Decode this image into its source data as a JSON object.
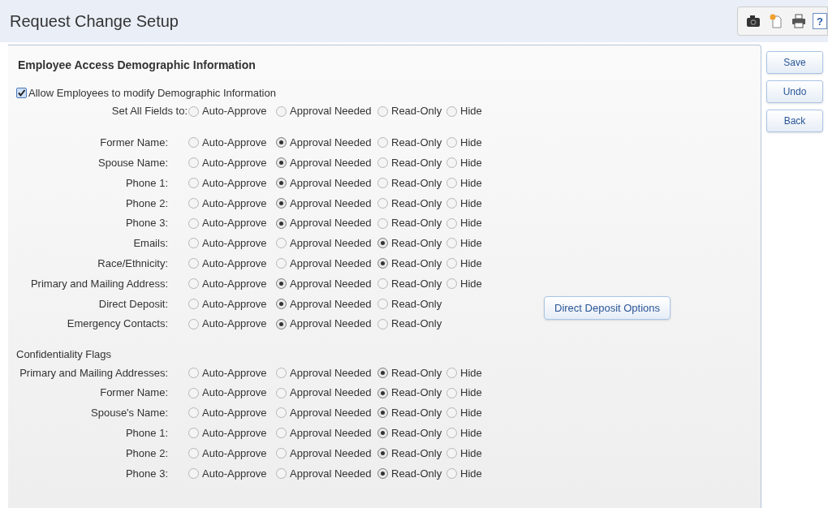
{
  "header": {
    "title": "Request Change Setup",
    "toolbar": [
      {
        "kind": "camera"
      },
      {
        "kind": "document"
      },
      {
        "kind": "printer"
      },
      {
        "kind": "help",
        "label": "?"
      }
    ]
  },
  "demographic": {
    "title": "Employee Access Demographic Information",
    "allow": {
      "label": "Allow Employees to modify Demographic Information",
      "checked": true
    },
    "set_all": {
      "label": "Set All Fields to:",
      "options": [
        {
          "label": "Auto-Approve",
          "selected": false
        },
        {
          "label": "Approval Needed",
          "selected": false
        },
        {
          "label": "Read-Only",
          "selected": false
        },
        {
          "label": "Hide",
          "selected": false
        }
      ]
    },
    "fields": [
      {
        "label": "Former Name:",
        "options": [
          {
            "label": "Auto-Approve",
            "selected": false
          },
          {
            "label": "Approval Needed",
            "selected": true
          },
          {
            "label": "Read-Only",
            "selected": false
          },
          {
            "label": "Hide",
            "selected": false
          }
        ]
      },
      {
        "label": "Spouse Name:",
        "options": [
          {
            "label": "Auto-Approve",
            "selected": false
          },
          {
            "label": "Approval Needed",
            "selected": true
          },
          {
            "label": "Read-Only",
            "selected": false
          },
          {
            "label": "Hide",
            "selected": false
          }
        ]
      },
      {
        "label": "Phone 1:",
        "options": [
          {
            "label": "Auto-Approve",
            "selected": false
          },
          {
            "label": "Approval Needed",
            "selected": true
          },
          {
            "label": "Read-Only",
            "selected": false
          },
          {
            "label": "Hide",
            "selected": false
          }
        ]
      },
      {
        "label": "Phone 2:",
        "options": [
          {
            "label": "Auto-Approve",
            "selected": false
          },
          {
            "label": "Approval Needed",
            "selected": true
          },
          {
            "label": "Read-Only",
            "selected": false
          },
          {
            "label": "Hide",
            "selected": false
          }
        ]
      },
      {
        "label": "Phone 3:",
        "options": [
          {
            "label": "Auto-Approve",
            "selected": false
          },
          {
            "label": "Approval Needed",
            "selected": true
          },
          {
            "label": "Read-Only",
            "selected": false
          },
          {
            "label": "Hide",
            "selected": false
          }
        ]
      },
      {
        "label": "Emails:",
        "options": [
          {
            "label": "Auto-Approve",
            "selected": false
          },
          {
            "label": "Approval Needed",
            "selected": false
          },
          {
            "label": "Read-Only",
            "selected": true
          },
          {
            "label": "Hide",
            "selected": false
          }
        ]
      },
      {
        "label": "Race/Ethnicity:",
        "options": [
          {
            "label": "Auto-Approve",
            "selected": false
          },
          {
            "label": "Approval Needed",
            "selected": false
          },
          {
            "label": "Read-Only",
            "selected": true
          },
          {
            "label": "Hide",
            "selected": false
          }
        ]
      },
      {
        "label": "Primary and Mailing Address:",
        "options": [
          {
            "label": "Auto-Approve",
            "selected": false
          },
          {
            "label": "Approval Needed",
            "selected": true
          },
          {
            "label": "Read-Only",
            "selected": false
          },
          {
            "label": "Hide",
            "selected": false
          }
        ]
      },
      {
        "label": "Direct Deposit:",
        "options": [
          {
            "label": "Auto-Approve",
            "selected": false
          },
          {
            "label": "Approval Needed",
            "selected": true
          },
          {
            "label": "Read-Only",
            "selected": false
          }
        ],
        "button": "Direct Deposit Options"
      },
      {
        "label": "Emergency Contacts:",
        "options": [
          {
            "label": "Auto-Approve",
            "selected": false
          },
          {
            "label": "Approval Needed",
            "selected": true
          },
          {
            "label": "Read-Only",
            "selected": false
          }
        ]
      }
    ]
  },
  "confidentiality": {
    "title": "Confidentiality Flags",
    "fields": [
      {
        "label": "Primary and Mailing Addresses:",
        "options": [
          {
            "label": "Auto-Approve",
            "selected": false
          },
          {
            "label": "Approval Needed",
            "selected": false
          },
          {
            "label": "Read-Only",
            "selected": true
          },
          {
            "label": "Hide",
            "selected": false
          }
        ]
      },
      {
        "label": "Former Name:",
        "options": [
          {
            "label": "Auto-Approve",
            "selected": false
          },
          {
            "label": "Approval Needed",
            "selected": false
          },
          {
            "label": "Read-Only",
            "selected": true
          },
          {
            "label": "Hide",
            "selected": false
          }
        ]
      },
      {
        "label": "Spouse's Name:",
        "options": [
          {
            "label": "Auto-Approve",
            "selected": false
          },
          {
            "label": "Approval Needed",
            "selected": false
          },
          {
            "label": "Read-Only",
            "selected": true
          },
          {
            "label": "Hide",
            "selected": false
          }
        ]
      },
      {
        "label": "Phone 1:",
        "options": [
          {
            "label": "Auto-Approve",
            "selected": false
          },
          {
            "label": "Approval Needed",
            "selected": false
          },
          {
            "label": "Read-Only",
            "selected": true
          },
          {
            "label": "Hide",
            "selected": false
          }
        ]
      },
      {
        "label": "Phone 2:",
        "options": [
          {
            "label": "Auto-Approve",
            "selected": false
          },
          {
            "label": "Approval Needed",
            "selected": false
          },
          {
            "label": "Read-Only",
            "selected": true
          },
          {
            "label": "Hide",
            "selected": false
          }
        ]
      },
      {
        "label": "Phone 3:",
        "options": [
          {
            "label": "Auto-Approve",
            "selected": false
          },
          {
            "label": "Approval Needed",
            "selected": false
          },
          {
            "label": "Read-Only",
            "selected": true
          },
          {
            "label": "Hide",
            "selected": false
          }
        ]
      }
    ]
  },
  "actions": [
    {
      "label": "Save"
    },
    {
      "label": "Undo"
    },
    {
      "label": "Back"
    }
  ]
}
